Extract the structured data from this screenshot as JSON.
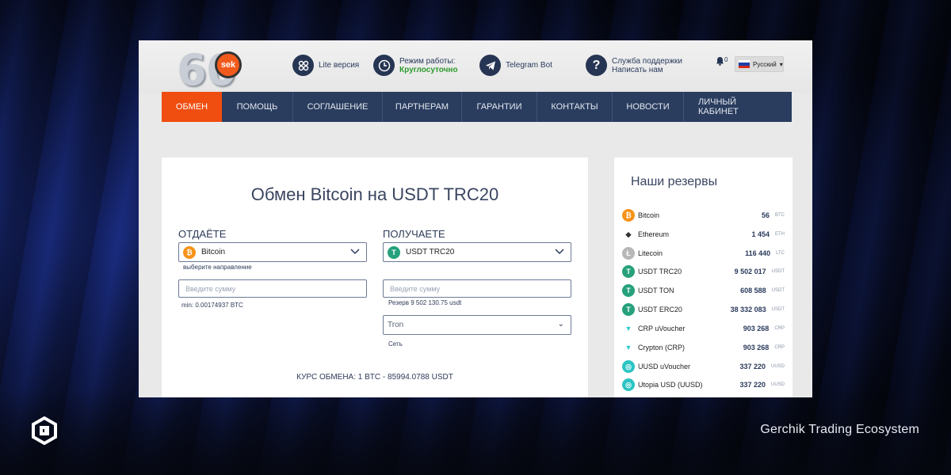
{
  "footer": {
    "brand": "Gerchik Trading Ecosystem"
  },
  "logo": {
    "number": "60",
    "badge": "sek"
  },
  "topbar": {
    "lite": {
      "icon": "grid-icon",
      "label": "Lite версия"
    },
    "hours": {
      "icon": "clock-icon",
      "label": "Режим работы:",
      "value": "Круглосуточно"
    },
    "telegram": {
      "icon": "telegram-icon",
      "label": "Telegram Bot"
    },
    "support": {
      "icon": "question-icon",
      "label": "Служба поддержки",
      "sub": "Написать нам"
    },
    "notifications": {
      "count": "0"
    },
    "language": {
      "label": "Русский"
    }
  },
  "nav": {
    "items": [
      "ОБМЕН",
      "ПОМОЩЬ",
      "СОГЛАШЕНИЕ",
      "ПАРТНЕРАМ",
      "ГАРАНТИИ",
      "КОНТАКТЫ",
      "НОВОСТИ",
      "ЛИЧНЫЙ КАБИНЕТ"
    ],
    "active": "ОБМЕН"
  },
  "exchange": {
    "title": "Обмен Bitcoin на USDT TRC20",
    "give": {
      "label": "ОТДАЁТЕ",
      "currency": "Bitcoin",
      "hint": "выберите направление",
      "placeholder": "Введите сумму",
      "min": "min: 0.00174937 BTC"
    },
    "get": {
      "label": "ПОЛУЧАЕТЕ",
      "currency": "USDT TRC20",
      "placeholder": "Введите сумму",
      "reserve": "Резерв 9 502 130.75 usdt",
      "network": "Tron",
      "network_label": "Сеть"
    },
    "rate": "КУРС ОБМЕНА: 1 BTC - 85994.0788 USDT"
  },
  "reserves": {
    "title": "Наши резервы",
    "items": [
      {
        "name": "Bitcoin",
        "amount": "56",
        "unit": "BTC"
      },
      {
        "name": "Ethereum",
        "amount": "1 454",
        "unit": "ETH"
      },
      {
        "name": "Litecoin",
        "amount": "116 440",
        "unit": "LTC"
      },
      {
        "name": "USDT TRC20",
        "amount": "9 502 017",
        "unit": "USDT"
      },
      {
        "name": "USDT TON",
        "amount": "608 588",
        "unit": "USDT"
      },
      {
        "name": "USDT ERC20",
        "amount": "38 332 083",
        "unit": "USDT"
      },
      {
        "name": "CRP uVoucher",
        "amount": "903 268",
        "unit": "CRP"
      },
      {
        "name": "Crypton (CRP)",
        "amount": "903 268",
        "unit": "CRP"
      },
      {
        "name": "UUSD uVoucher",
        "amount": "337 220",
        "unit": "UUSD"
      },
      {
        "name": "Utopia USD (UUSD)",
        "amount": "337 220",
        "unit": "UUSD"
      }
    ]
  }
}
